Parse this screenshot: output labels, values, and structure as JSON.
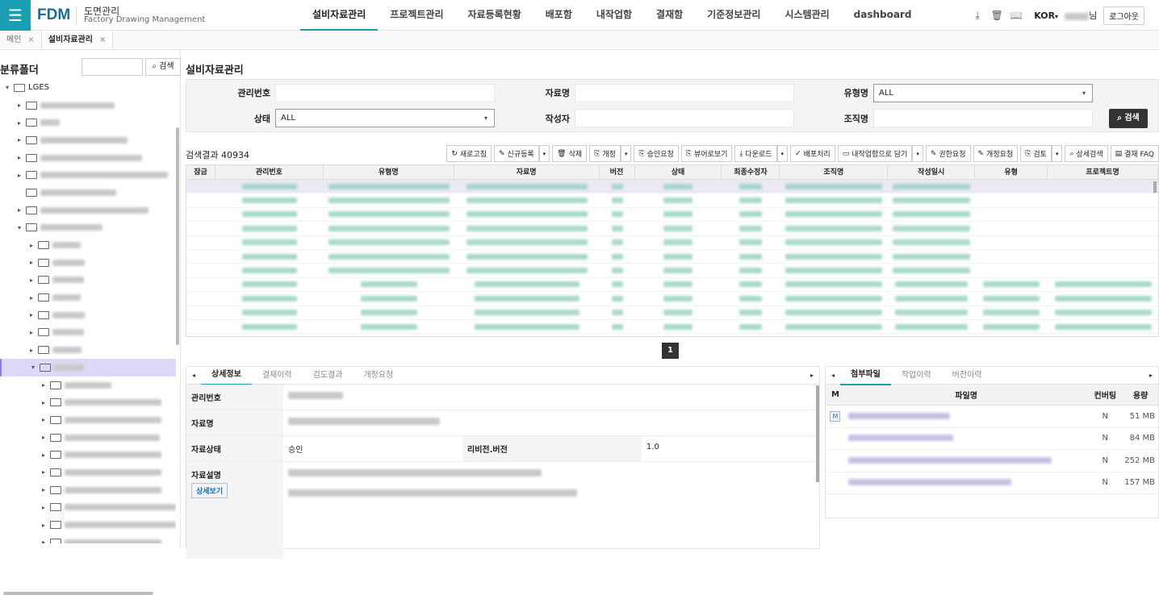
{
  "header": {
    "logo": "FDM",
    "title": "도면관리",
    "subtitle": "Factory Drawing Management",
    "nav": [
      "설비자료관리",
      "프로젝트관리",
      "자료등록현황",
      "배포함",
      "내작업함",
      "결재함",
      "기준정보관리",
      "시스템관리",
      "dashboard"
    ],
    "active_nav": 0,
    "lang": "KOR",
    "user_suffix": "님",
    "logout": "로그아웃"
  },
  "tabs": [
    {
      "label": "메인",
      "close": "×"
    },
    {
      "label": "설비자료관리",
      "close": "×"
    }
  ],
  "tree": {
    "title": "분류폴더",
    "search_btn": "검색",
    "root": "LGES",
    "nodes": [
      {
        "level": 1,
        "tog": "▸",
        "w": 92
      },
      {
        "level": 1,
        "tog": "▸",
        "w": 24
      },
      {
        "level": 1,
        "tog": "▸",
        "w": 108
      },
      {
        "level": 1,
        "tog": "▸",
        "w": 126
      },
      {
        "level": 1,
        "tog": "▸",
        "w": 158
      },
      {
        "level": 1,
        "tog": "",
        "w": 94
      },
      {
        "level": 1,
        "tog": "▸",
        "w": 134
      },
      {
        "level": 1,
        "tog": "▾",
        "w": 77
      },
      {
        "level": 2,
        "tog": "▸",
        "w": 35
      },
      {
        "level": 2,
        "tog": "▸",
        "w": 40
      },
      {
        "level": 2,
        "tog": "▸",
        "w": 39
      },
      {
        "level": 2,
        "tog": "▸",
        "w": 35
      },
      {
        "level": 2,
        "tog": "▸",
        "w": 40
      },
      {
        "level": 2,
        "tog": "▸",
        "w": 39
      },
      {
        "level": 2,
        "tog": "▸",
        "w": 36
      },
      {
        "level": 2,
        "tog": "▾",
        "w": 37,
        "sel": true
      },
      {
        "level": 3,
        "tog": "▸",
        "w": 58
      },
      {
        "level": 3,
        "tog": "▸",
        "w": 120
      },
      {
        "level": 3,
        "tog": "▸",
        "w": 120
      },
      {
        "level": 3,
        "tog": "▸",
        "w": 118
      },
      {
        "level": 3,
        "tog": "▸",
        "w": 120
      },
      {
        "level": 3,
        "tog": "▸",
        "w": 120
      },
      {
        "level": 3,
        "tog": "▸",
        "w": 120
      },
      {
        "level": 3,
        "tog": "▸",
        "w": 140
      },
      {
        "level": 3,
        "tog": "▸",
        "w": 140
      },
      {
        "level": 3,
        "tog": "▸",
        "w": 120
      }
    ]
  },
  "main": {
    "title": "설비자료관리",
    "form": {
      "mgmt_no": "관리번호",
      "doc_name": "자료명",
      "type_name": "유형명",
      "type_value": "ALL",
      "status": "상태",
      "status_value": "ALL",
      "author": "작성자",
      "org": "조직명",
      "search": "검색"
    },
    "result_count": "검색결과 40934",
    "toolbar": [
      {
        "label": "새로고침",
        "icon": "↻",
        "dd": false
      },
      {
        "label": "신규등록",
        "icon": "✎",
        "dd": true
      },
      {
        "label": "삭제",
        "icon": "🗑",
        "dd": false
      },
      {
        "label": "개정",
        "icon": "⎘",
        "dd": true
      },
      {
        "label": "승인요청",
        "icon": "⎘",
        "dd": false
      },
      {
        "label": "뷰어로보기",
        "icon": "⎘",
        "dd": false
      },
      {
        "label": "다운로드",
        "icon": "⤓",
        "dd": true
      },
      {
        "label": "배포처리",
        "icon": "✓",
        "dd": false
      },
      {
        "label": "내작업함으로 담기",
        "icon": "▭",
        "dd": true
      },
      {
        "label": "권한요청",
        "icon": "✎",
        "dd": false
      },
      {
        "label": "개정요청",
        "icon": "✎",
        "dd": false
      },
      {
        "label": "검토",
        "icon": "⎘",
        "dd": true
      },
      {
        "label": "상세검색",
        "icon": "⌕",
        "dd": false
      },
      {
        "label": "결재 FAQ",
        "icon": "▤",
        "dd": false
      }
    ],
    "columns": [
      "잠금",
      "관리번호",
      "유형명",
      "자료명",
      "버전",
      "상태",
      "최종수정자",
      "조직명",
      "작성일시",
      "유형",
      "프로젝트명"
    ],
    "page": "1"
  },
  "detail": {
    "tabs": [
      "상세정보",
      "결재이력",
      "검도결과",
      "개정요청"
    ],
    "active_tab": 0,
    "labels": {
      "mgmt_no": "관리번호",
      "doc_name": "자료명",
      "doc_status": "자료상태",
      "revision": "리비전.버전",
      "desc": "자료설명",
      "detail_btn": "상세보기"
    },
    "doc_status_value": "승인",
    "revision_value": "1.0"
  },
  "files": {
    "tabs": [
      "첨부파일",
      "작업이력",
      "버전이력"
    ],
    "active_tab": 0,
    "columns": [
      "M",
      "파일명",
      "컨버팅",
      "용량"
    ],
    "rows": [
      {
        "m": "M",
        "conv": "N",
        "size": "51 MB",
        "w": 126
      },
      {
        "m": "",
        "conv": "N",
        "size": "84 MB",
        "w": 130
      },
      {
        "m": "",
        "conv": "N",
        "size": "252 MB",
        "w": 252
      },
      {
        "m": "",
        "conv": "N",
        "size": "157 MB",
        "w": 202
      }
    ]
  },
  "colors": {
    "brand": "#1a9eb4",
    "selected": "#ddd8f5",
    "blurtext": "#9dd4c3"
  }
}
